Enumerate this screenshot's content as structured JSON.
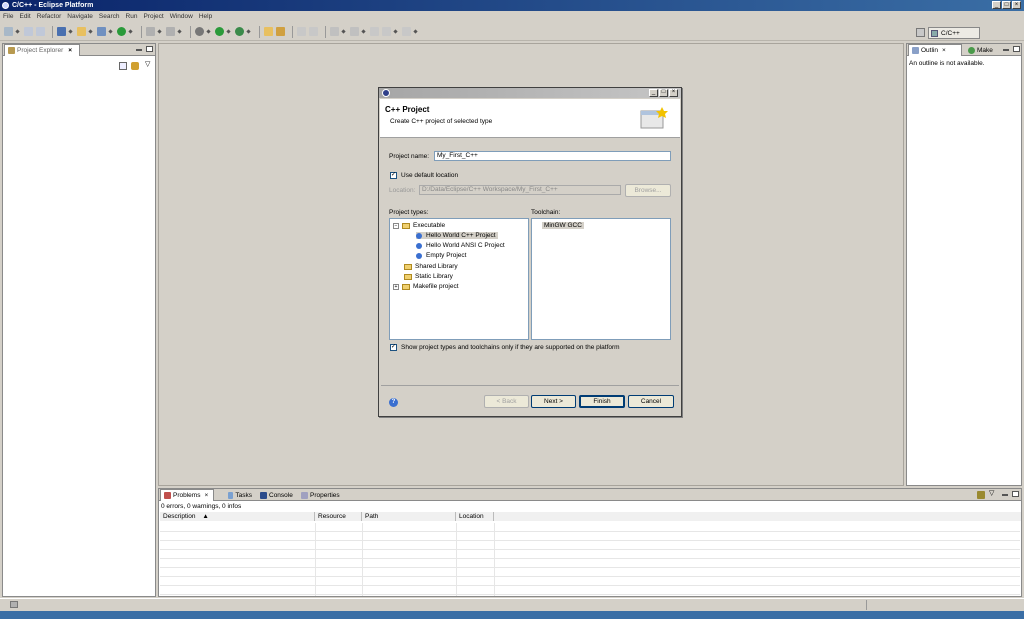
{
  "window": {
    "title": "C/C++ - Eclipse Platform"
  },
  "menu": [
    "File",
    "Edit",
    "Refactor",
    "Navigate",
    "Search",
    "Run",
    "Project",
    "Window",
    "Help"
  ],
  "perspective": {
    "label": "C/C++"
  },
  "project_explorer": {
    "tab": "Project Explorer"
  },
  "outline": {
    "tab": "Outlin",
    "make_tab": "Make",
    "message": "An outline is not available."
  },
  "dialog": {
    "header_title": "C++ Project",
    "header_desc": "Create C++ project of selected type",
    "project_name_label": "Project name:",
    "project_name_value": "My_First_C++",
    "use_default_location": "Use default location",
    "location_label": "Location:",
    "location_value": "D:/Data/Eclipse/C++ Workspace/My_First_C++",
    "browse": "Browse...",
    "project_types_label": "Project types:",
    "toolchain_label": "Toolchain:",
    "tree": {
      "executable": "Executable",
      "hello_cpp": "Hello World C++ Project",
      "hello_c": "Hello World ANSI C Project",
      "empty": "Empty Project",
      "shared": "Shared Library",
      "static": "Static Library",
      "makefile": "Makefile project"
    },
    "toolchain_item": "MinGW GCC",
    "show_supported": "Show project types and toolchains only if they are supported on the platform",
    "buttons": {
      "back": "< Back",
      "next": "Next >",
      "finish": "Finish",
      "cancel": "Cancel"
    }
  },
  "bottom": {
    "tabs": {
      "problems": "Problems",
      "tasks": "Tasks",
      "console": "Console",
      "properties": "Properties"
    },
    "summary": "0 errors, 0 warnings, 0 infos",
    "columns": {
      "description": "Description",
      "resource": "Resource",
      "path": "Path",
      "location": "Location"
    }
  }
}
